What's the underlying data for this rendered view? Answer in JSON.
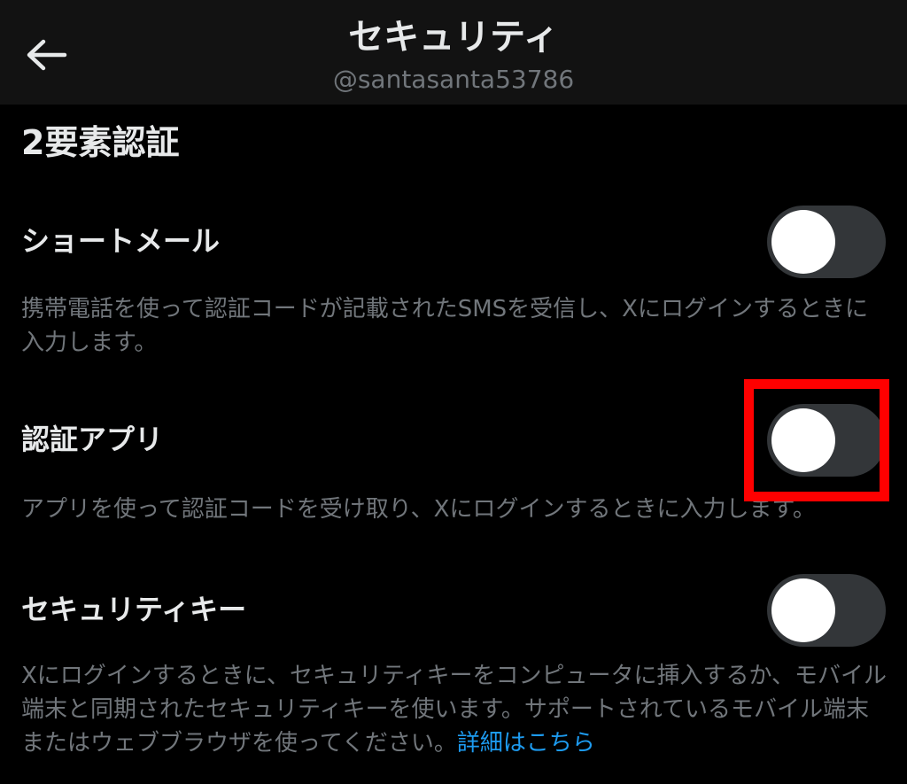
{
  "header": {
    "title": "セキュリティ",
    "subtitle": "@santasanta53786",
    "back_icon": "arrow-left-icon"
  },
  "section": {
    "heading": "2要素認証"
  },
  "options": [
    {
      "label": "ショートメール",
      "description": "携帯電話を使って認証コードが記載されたSMSを受信し、Xにログインするときに入力します。",
      "enabled": false
    },
    {
      "label": "認証アプリ",
      "description": "アプリを使って認証コードを受け取り、Xにログインするときに入力します。",
      "enabled": false
    },
    {
      "label": "セキュリティキー",
      "description": "Xにログインするときに、セキュリティキーをコンピュータに挿入するか、モバイル端末と同期されたセキュリティキーを使います。サポートされているモバイル端末またはウェブブラウザを使ってください。",
      "link_text": "詳細はこちら",
      "enabled": false
    }
  ],
  "colors": {
    "background": "#000000",
    "header_background": "#121212",
    "text_primary": "#e7e9ea",
    "text_secondary": "#71767b",
    "link": "#1d9bf0",
    "toggle_off_track": "#333639",
    "toggle_knob": "#ffffff",
    "highlight": "#ff0000"
  }
}
